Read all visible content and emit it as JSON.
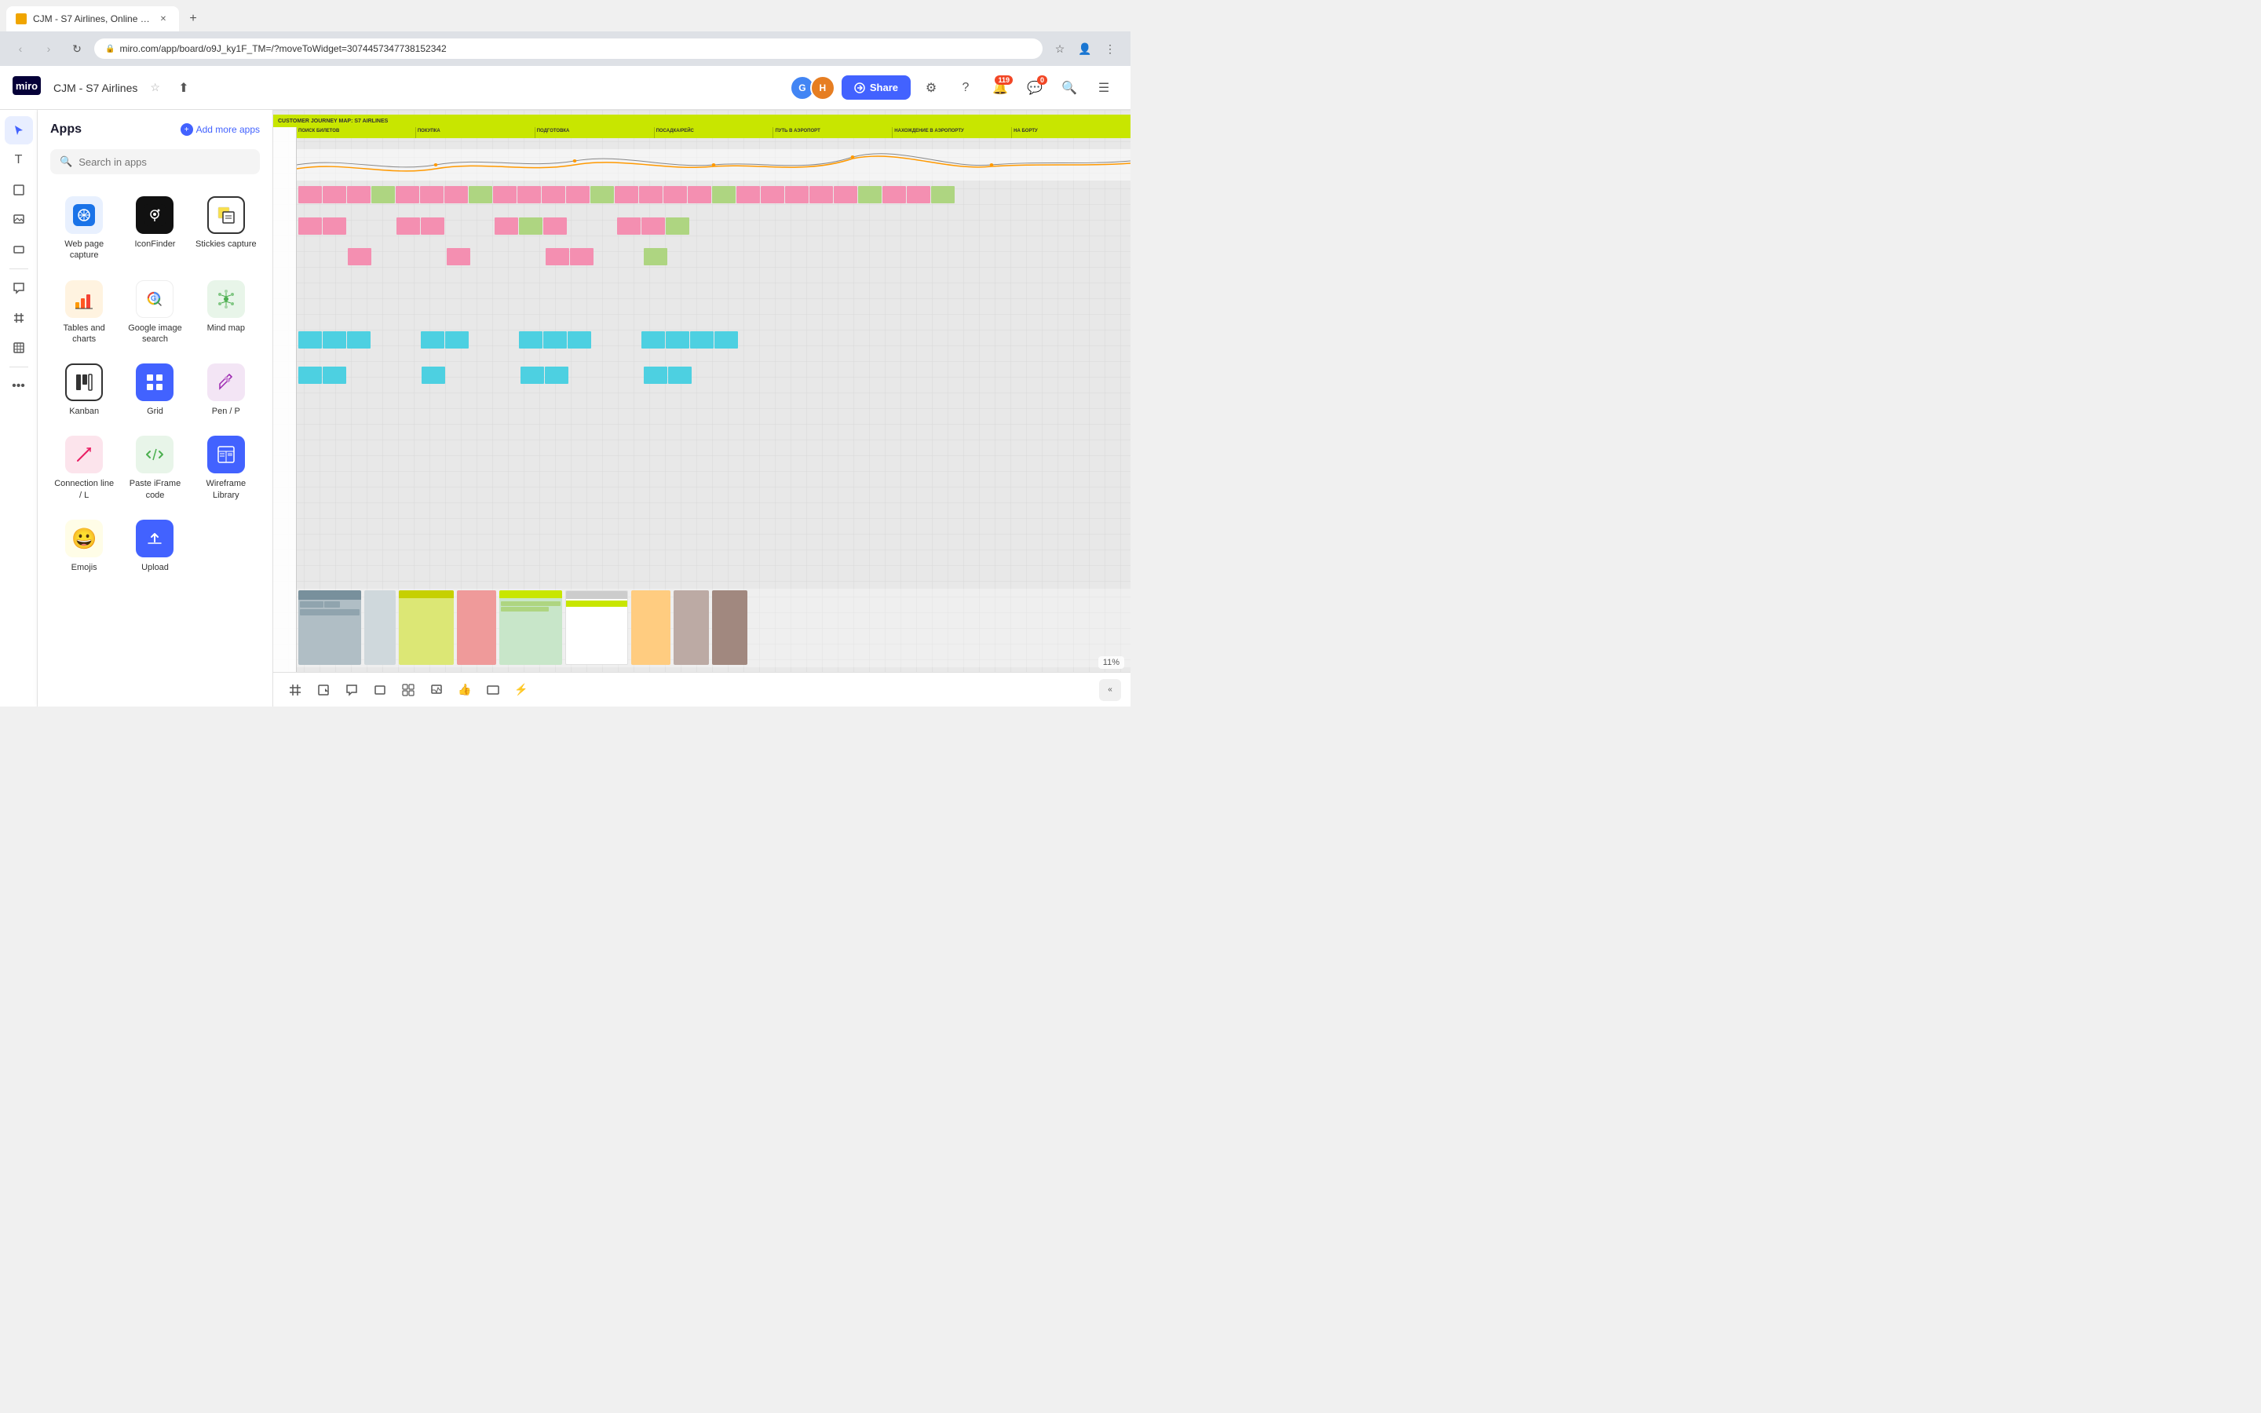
{
  "browser": {
    "tab_title": "CJM - S7 Airlines, Online Whit...",
    "url": "miro.com/app/board/o9J_ky1F_TM=/?moveToWidget=3074457347738152342",
    "new_tab_label": "+"
  },
  "toolbar": {
    "logo": "miro",
    "board_title": "CJM - S7 Airlines",
    "share_label": "Share",
    "notifications_count": "119",
    "comments_count": "0"
  },
  "apps_panel": {
    "title": "Apps",
    "add_more_label": "Add more apps",
    "search_placeholder": "Search in apps",
    "apps": [
      {
        "id": "webpage",
        "label": "Web page capture",
        "icon_type": "webpage"
      },
      {
        "id": "iconfinder",
        "label": "IconFinder",
        "icon_type": "iconfinder"
      },
      {
        "id": "stickies",
        "label": "Stickies capture",
        "icon_type": "stickies"
      },
      {
        "id": "tables",
        "label": "Tables and charts",
        "icon_type": "tables"
      },
      {
        "id": "google-img",
        "label": "Google image search",
        "icon_type": "google-img"
      },
      {
        "id": "mindmap",
        "label": "Mind map",
        "icon_type": "mindmap"
      },
      {
        "id": "kanban",
        "label": "Kanban",
        "icon_type": "kanban"
      },
      {
        "id": "grid",
        "label": "Grid",
        "icon_type": "grid"
      },
      {
        "id": "pen",
        "label": "Pen / P",
        "icon_type": "pen"
      },
      {
        "id": "connection",
        "label": "Connection line / L",
        "icon_type": "connection"
      },
      {
        "id": "paste-iframe",
        "label": "Paste iFrame code",
        "icon_type": "paste-iframe"
      },
      {
        "id": "wireframe",
        "label": "Wireframe Library",
        "icon_type": "wireframe"
      },
      {
        "id": "emojis",
        "label": "Emojis",
        "icon_type": "emojis"
      },
      {
        "id": "upload",
        "label": "Upload",
        "icon_type": "upload"
      }
    ]
  },
  "canvas": {
    "zoom": "11%"
  },
  "bottom_tools": [
    "frames",
    "sticky-note",
    "comment",
    "shape",
    "layout",
    "export",
    "like",
    "screen",
    "lightning"
  ]
}
